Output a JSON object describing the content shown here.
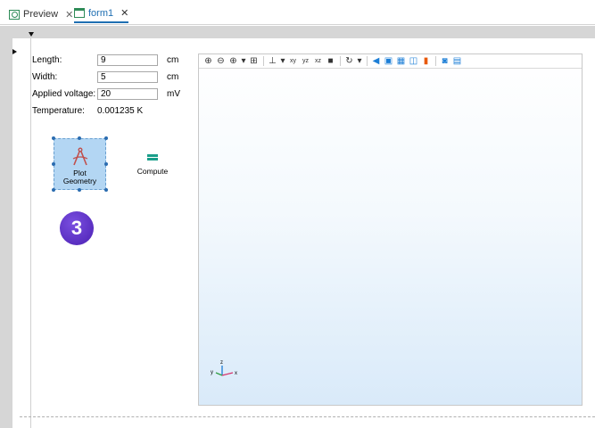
{
  "tabs": [
    {
      "label": "Preview"
    },
    {
      "label": "form1"
    }
  ],
  "form": {
    "length": {
      "label": "Length:",
      "value": "9",
      "unit": "cm"
    },
    "width": {
      "label": "Width:",
      "value": "5",
      "unit": "cm"
    },
    "voltage": {
      "label": "Applied voltage:",
      "value": "20",
      "unit": "mV"
    },
    "temperature": {
      "label": "Temperature:",
      "value": "0.001235 K"
    }
  },
  "buttons": {
    "plot_geometry_line1": "Plot",
    "plot_geometry_line2": "Geometry",
    "compute": "Compute"
  },
  "badge": "3",
  "graphics": {
    "axes": {
      "z": "z",
      "y": "y",
      "x": "x"
    },
    "axis_colors": {
      "x": "#d6336c",
      "y": "#2f9e44",
      "z": "#1c7ed6"
    }
  },
  "colors": {
    "accent": "#1f6fb2",
    "compute_icon": "#1a9e8a",
    "badge": "#5b2fc9"
  }
}
